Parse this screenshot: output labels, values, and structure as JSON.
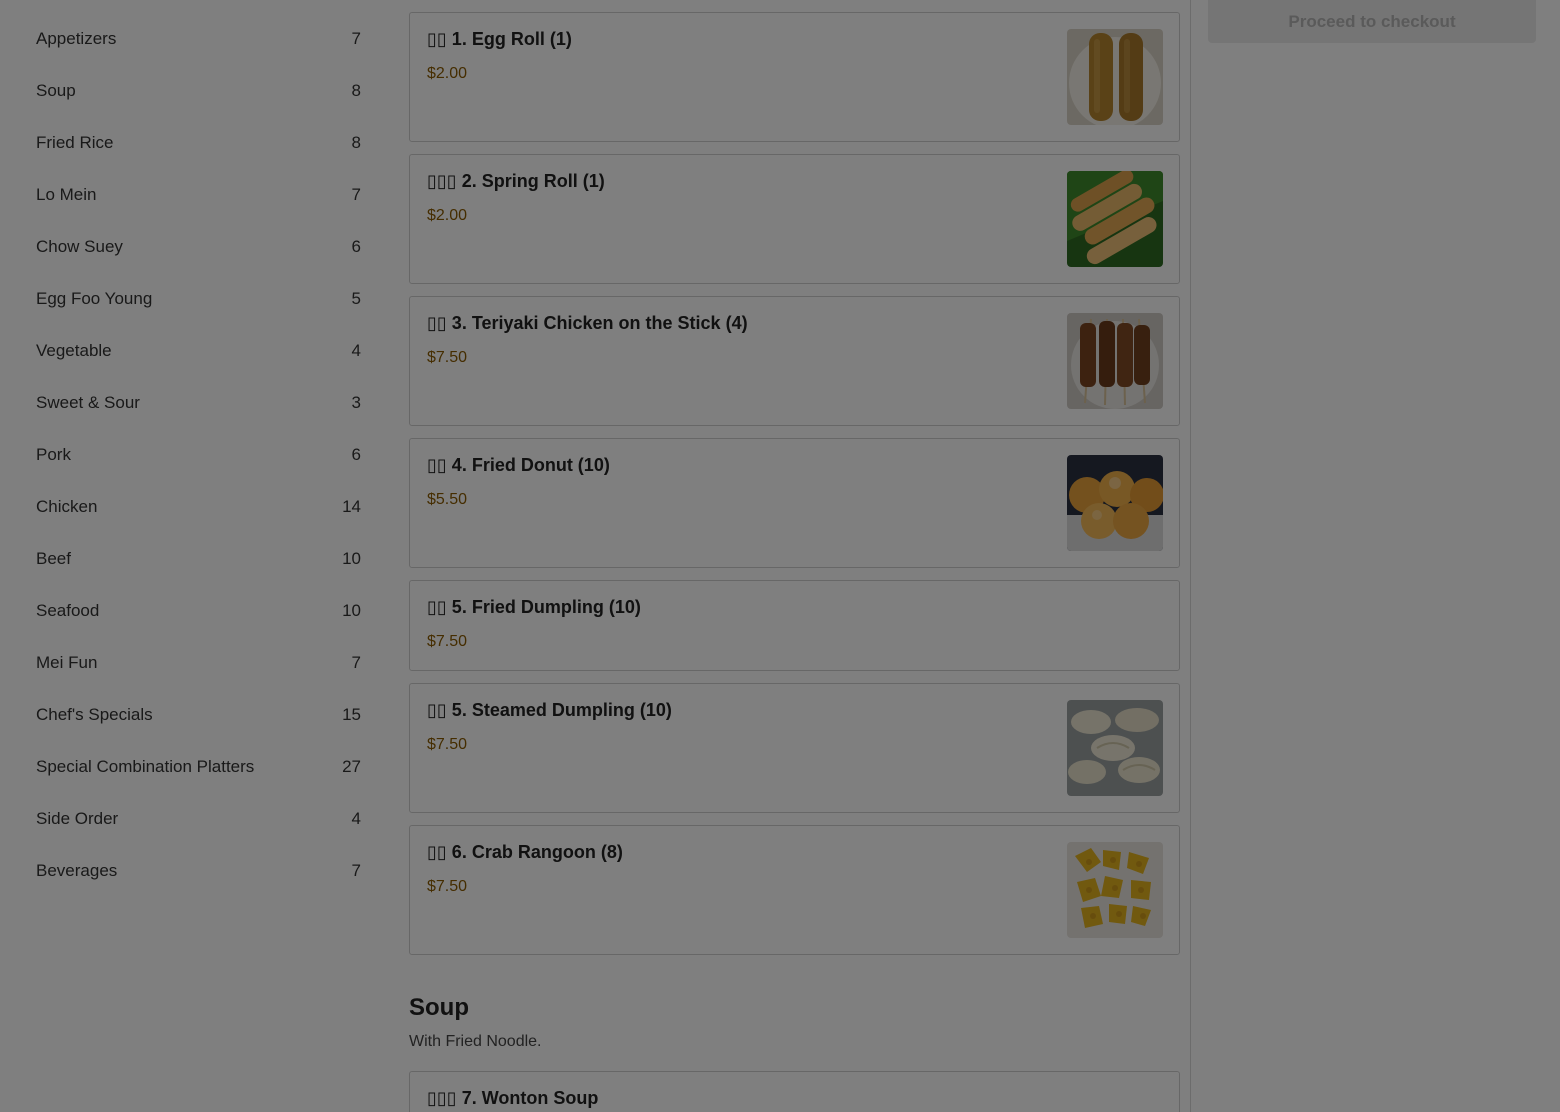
{
  "sidebar": {
    "categories": [
      {
        "label": "Appetizers",
        "count": "7"
      },
      {
        "label": "Soup",
        "count": "8"
      },
      {
        "label": "Fried Rice",
        "count": "8"
      },
      {
        "label": "Lo Mein",
        "count": "7"
      },
      {
        "label": "Chow Suey",
        "count": "6"
      },
      {
        "label": "Egg Foo Young",
        "count": "5"
      },
      {
        "label": "Vegetable",
        "count": "4"
      },
      {
        "label": "Sweet & Sour",
        "count": "3"
      },
      {
        "label": "Pork",
        "count": "6"
      },
      {
        "label": "Chicken",
        "count": "14"
      },
      {
        "label": "Beef",
        "count": "10"
      },
      {
        "label": "Seafood",
        "count": "10"
      },
      {
        "label": "Mei Fun",
        "count": "7"
      },
      {
        "label": "Chef's Specials",
        "count": "15"
      },
      {
        "label": "Special Combination Platters",
        "count": "27"
      },
      {
        "label": "Side Order",
        "count": "4"
      },
      {
        "label": "Beverages",
        "count": "7"
      }
    ]
  },
  "menu": {
    "items": [
      {
        "name": "▯▯ 1. Egg Roll (1)",
        "price": "$2.00"
      },
      {
        "name": "▯▯▯ 2. Spring Roll (1)",
        "price": "$2.00"
      },
      {
        "name": "▯▯ 3. Teriyaki Chicken on the Stick (4)",
        "price": "$7.50"
      },
      {
        "name": "▯▯ 4. Fried Donut (10)",
        "price": "$5.50"
      },
      {
        "name": "▯▯ 5. Fried Dumpling (10)",
        "price": "$7.50"
      },
      {
        "name": "▯▯ 5. Steamed Dumpling (10)",
        "price": "$7.50"
      },
      {
        "name": "▯▯ 6. Crab Rangoon (8)",
        "price": "$7.50"
      }
    ],
    "soup_section": {
      "title": "Soup",
      "description": "With Fried Noodle.",
      "first_item": "▯▯▯ 7. Wonton Soup"
    }
  },
  "cart": {
    "checkout_label": "Proceed to checkout"
  },
  "colors": {
    "price": "#8a5a00",
    "overlay": "rgba(0,0,0,0.5)"
  }
}
